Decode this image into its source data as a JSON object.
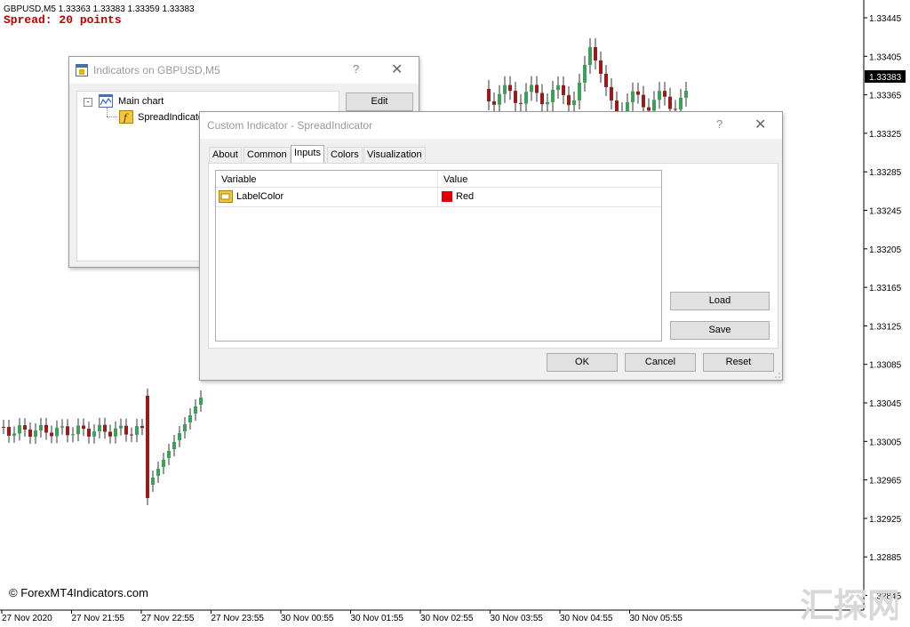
{
  "chart": {
    "header": "GBPUSD,M5  1.33363 1.33383 1.33359 1.33383",
    "spread_text": "Spread: 20 points",
    "watermark": "© ForexMT4Indicators.com",
    "current_price": "1.33383",
    "up_color": "#3aa05a",
    "down_color": "#9b1b1b",
    "price_labels": [
      "1.33445",
      "1.33405",
      "1.33365",
      "1.33325",
      "1.33285",
      "1.33245",
      "1.33205",
      "1.33165",
      "1.33125",
      "1.33085",
      "1.33045",
      "1.33005",
      "1.32965",
      "1.32925",
      "1.32885",
      "1.32845"
    ],
    "time_labels": [
      "27 Nov 2020",
      "27 Nov 21:55",
      "27 Nov 22:55",
      "27 Nov 23:55",
      "30 Nov 00:55",
      "30 Nov 01:55",
      "30 Nov 02:55",
      "30 Nov 03:55",
      "30 Nov 04:55",
      "30 Nov 05:55"
    ]
  },
  "indicators_dialog": {
    "title": "Indicators on GBPUSD,M5",
    "help": "?",
    "close": "✕",
    "tree_root": "Main chart",
    "tree_child": "SpreadIndicator",
    "edit_label": "Edit"
  },
  "custom_dialog": {
    "title": "Custom Indicator - SpreadIndicator",
    "help": "?",
    "close": "✕",
    "tabs": [
      "About",
      "Common",
      "Inputs",
      "Colors",
      "Visualization"
    ],
    "active_tab": "Inputs",
    "columns": [
      "Variable",
      "Value"
    ],
    "rows": [
      {
        "variable": "LabelColor",
        "value": "Red",
        "color": "#e00000"
      }
    ],
    "load_label": "Load",
    "save_label": "Save",
    "ok_label": "OK",
    "cancel_label": "Cancel",
    "reset_label": "Reset"
  },
  "logo_text": "汇探网"
}
